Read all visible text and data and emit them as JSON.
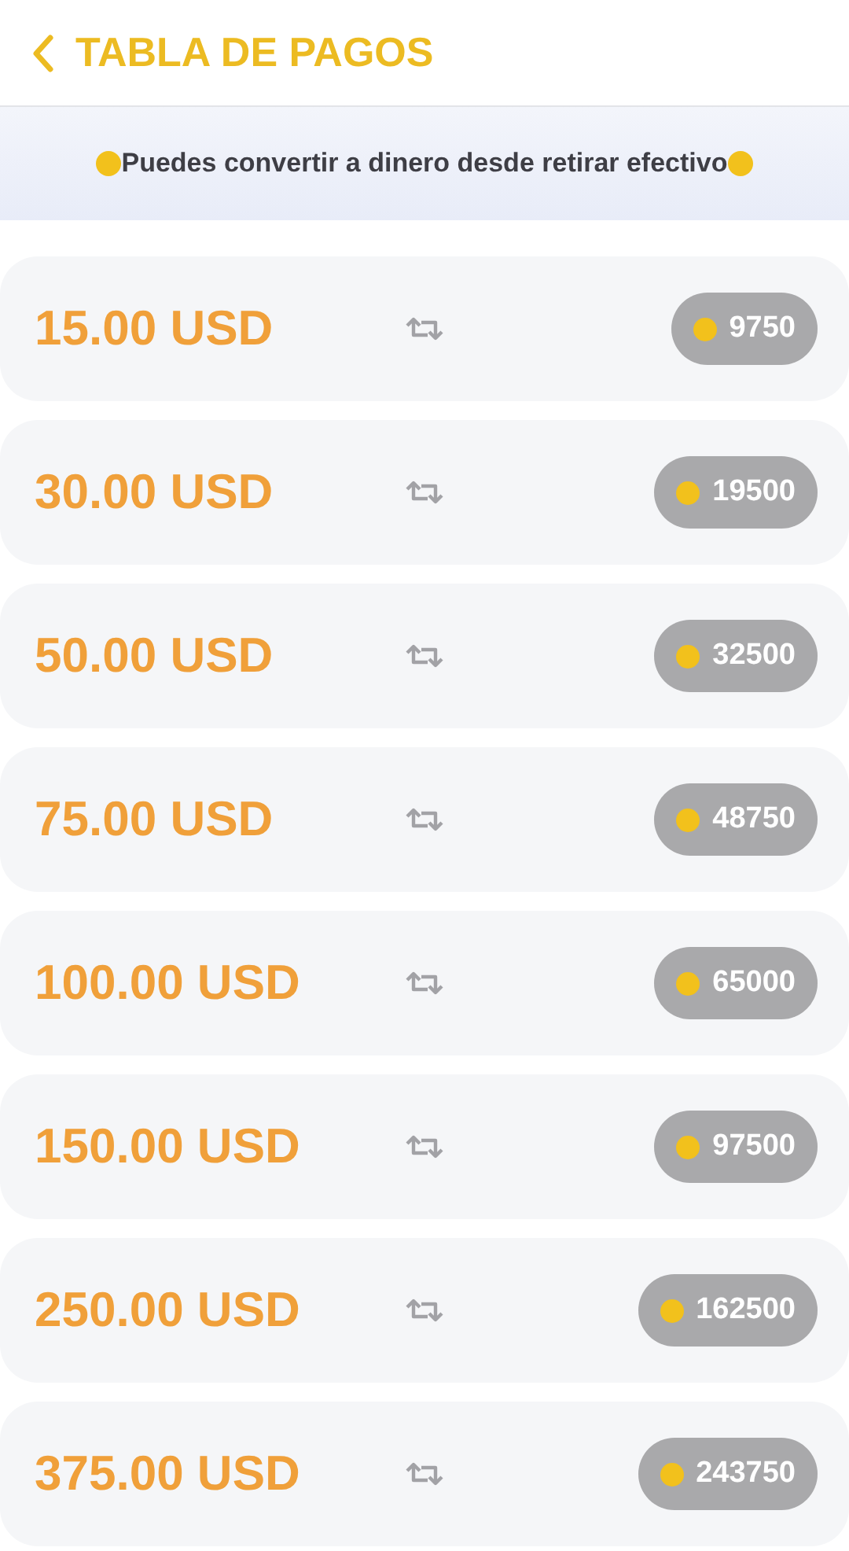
{
  "header": {
    "title": "TABLA DE PAGOS"
  },
  "banner": {
    "text": "Puedes convertir a dinero desde retirar efectivo"
  },
  "rates": [
    {
      "amount": "15.00 USD",
      "coins": "9750"
    },
    {
      "amount": "30.00 USD",
      "coins": "19500"
    },
    {
      "amount": "50.00 USD",
      "coins": "32500"
    },
    {
      "amount": "75.00 USD",
      "coins": "48750"
    },
    {
      "amount": "100.00 USD",
      "coins": "65000"
    },
    {
      "amount": "150.00 USD",
      "coins": "97500"
    },
    {
      "amount": "250.00 USD",
      "coins": "162500"
    },
    {
      "amount": "375.00 USD",
      "coins": "243750"
    }
  ]
}
